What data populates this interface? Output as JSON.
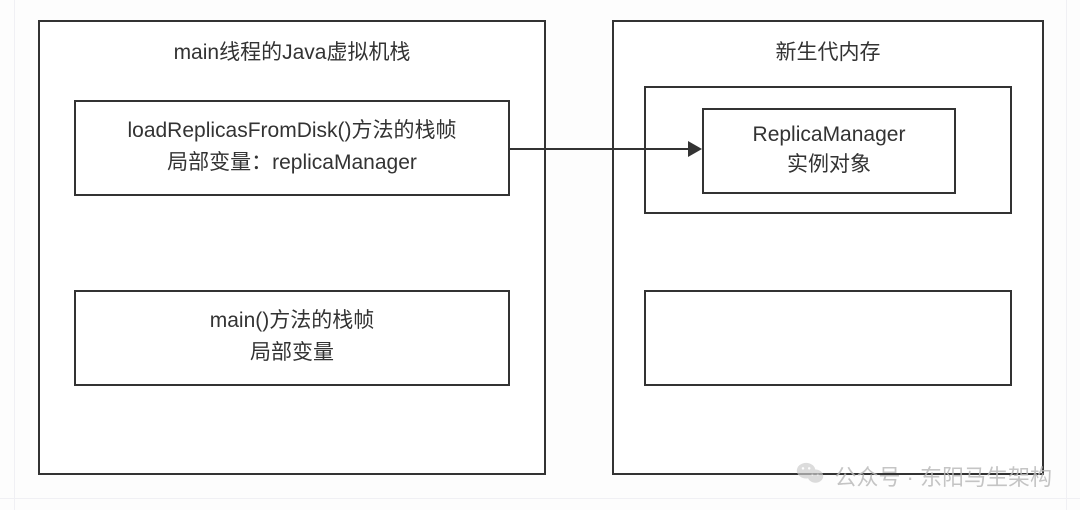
{
  "left_panel": {
    "title": "main线程的Java虚拟机栈",
    "frame_top": {
      "line1": "loadReplicasFromDisk()方法的栈帧",
      "line2": "局部变量：replicaManager"
    },
    "frame_bottom": {
      "line1": "main()方法的栈帧",
      "line2": "局部变量"
    }
  },
  "right_panel": {
    "title": "新生代内存",
    "object_box": {
      "line1": "ReplicaManager",
      "line2": "实例对象"
    }
  },
  "watermark": {
    "label": "公众号 · 东阳马生架构"
  }
}
